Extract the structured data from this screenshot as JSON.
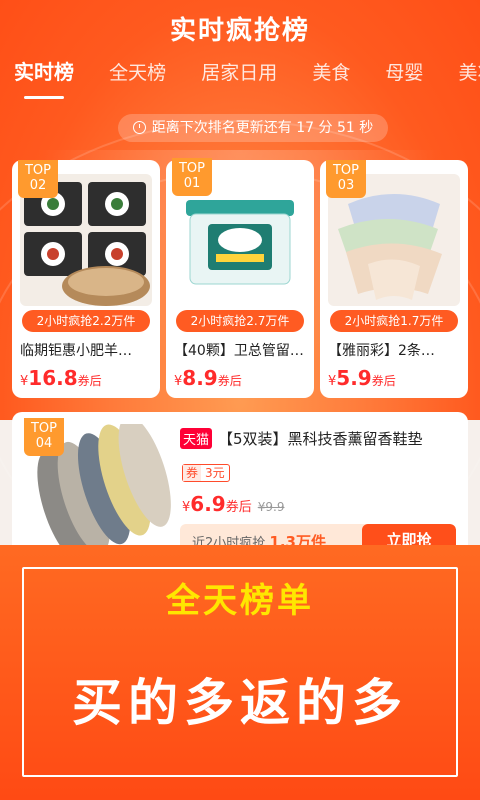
{
  "header": {
    "title": "实时疯抢榜",
    "tabs": [
      {
        "label": "实时榜",
        "active": true
      },
      {
        "label": "全天榜"
      },
      {
        "label": "居家日用"
      },
      {
        "label": "美食"
      },
      {
        "label": "母婴"
      },
      {
        "label": "美妆"
      }
    ],
    "countdown": "距离下次排名更新还有 17 分 51 秒"
  },
  "top3": [
    {
      "badge": "TOP\n02",
      "sold": "2小时疯抢2.2万件",
      "name": "临期钜惠小肥羊…",
      "price_symbol": "¥",
      "price": "16.8",
      "suffix": "券后"
    },
    {
      "badge": "TOP\n01",
      "sold": "2小时疯抢2.7万件",
      "name": "【40颗】卫总管留…",
      "price_symbol": "¥",
      "price": "8.9",
      "suffix": "券后"
    },
    {
      "badge": "TOP\n03",
      "sold": "2小时疯抢1.7万件",
      "name": "【雅丽彩】2条…",
      "price_symbol": "¥",
      "price": "5.9",
      "suffix": "券后"
    }
  ],
  "item4": {
    "badge": "TOP\n04",
    "platform": "天猫",
    "title": "【5双装】黑科技香薰留香鞋垫",
    "coupon_tag": "券",
    "coupon_value": "3元",
    "price_symbol": "¥",
    "price": "6.9",
    "suffix": "券后",
    "original_price": "¥9.9",
    "sold_prefix": "近2小时疯抢",
    "sold_count": "1.3万件",
    "buy_label": "立即抢"
  },
  "banner": {
    "title": "全天榜单",
    "subtitle": "买的多返的多"
  },
  "colors": {
    "brand_orange": "#ff5a1f",
    "price_red": "#ff2b2b",
    "badge_orange": "#ff9a2e",
    "banner_yellow": "#ffe600"
  }
}
